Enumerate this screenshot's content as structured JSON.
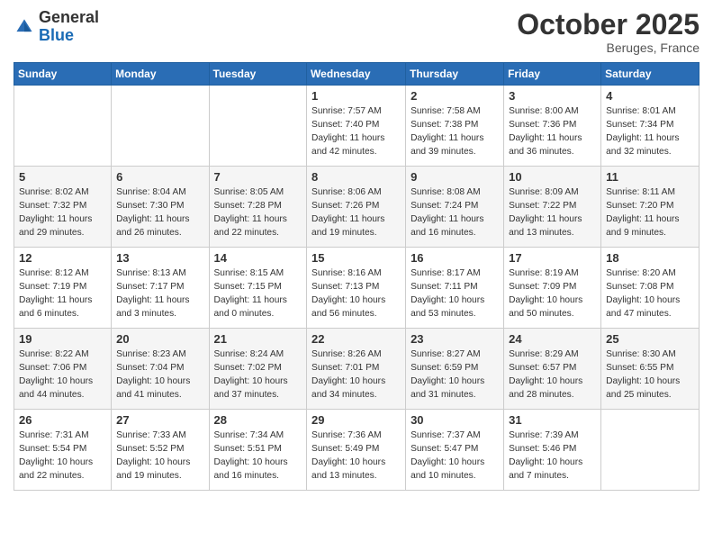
{
  "header": {
    "logo": {
      "general": "General",
      "blue": "Blue"
    },
    "title": "October 2025",
    "location": "Beruges, France"
  },
  "weekdays": [
    "Sunday",
    "Monday",
    "Tuesday",
    "Wednesday",
    "Thursday",
    "Friday",
    "Saturday"
  ],
  "weeks": [
    [
      {
        "day": "",
        "sunrise": "",
        "sunset": "",
        "daylight": ""
      },
      {
        "day": "",
        "sunrise": "",
        "sunset": "",
        "daylight": ""
      },
      {
        "day": "",
        "sunrise": "",
        "sunset": "",
        "daylight": ""
      },
      {
        "day": "1",
        "sunrise": "Sunrise: 7:57 AM",
        "sunset": "Sunset: 7:40 PM",
        "daylight": "Daylight: 11 hours and 42 minutes."
      },
      {
        "day": "2",
        "sunrise": "Sunrise: 7:58 AM",
        "sunset": "Sunset: 7:38 PM",
        "daylight": "Daylight: 11 hours and 39 minutes."
      },
      {
        "day": "3",
        "sunrise": "Sunrise: 8:00 AM",
        "sunset": "Sunset: 7:36 PM",
        "daylight": "Daylight: 11 hours and 36 minutes."
      },
      {
        "day": "4",
        "sunrise": "Sunrise: 8:01 AM",
        "sunset": "Sunset: 7:34 PM",
        "daylight": "Daylight: 11 hours and 32 minutes."
      }
    ],
    [
      {
        "day": "5",
        "sunrise": "Sunrise: 8:02 AM",
        "sunset": "Sunset: 7:32 PM",
        "daylight": "Daylight: 11 hours and 29 minutes."
      },
      {
        "day": "6",
        "sunrise": "Sunrise: 8:04 AM",
        "sunset": "Sunset: 7:30 PM",
        "daylight": "Daylight: 11 hours and 26 minutes."
      },
      {
        "day": "7",
        "sunrise": "Sunrise: 8:05 AM",
        "sunset": "Sunset: 7:28 PM",
        "daylight": "Daylight: 11 hours and 22 minutes."
      },
      {
        "day": "8",
        "sunrise": "Sunrise: 8:06 AM",
        "sunset": "Sunset: 7:26 PM",
        "daylight": "Daylight: 11 hours and 19 minutes."
      },
      {
        "day": "9",
        "sunrise": "Sunrise: 8:08 AM",
        "sunset": "Sunset: 7:24 PM",
        "daylight": "Daylight: 11 hours and 16 minutes."
      },
      {
        "day": "10",
        "sunrise": "Sunrise: 8:09 AM",
        "sunset": "Sunset: 7:22 PM",
        "daylight": "Daylight: 11 hours and 13 minutes."
      },
      {
        "day": "11",
        "sunrise": "Sunrise: 8:11 AM",
        "sunset": "Sunset: 7:20 PM",
        "daylight": "Daylight: 11 hours and 9 minutes."
      }
    ],
    [
      {
        "day": "12",
        "sunrise": "Sunrise: 8:12 AM",
        "sunset": "Sunset: 7:19 PM",
        "daylight": "Daylight: 11 hours and 6 minutes."
      },
      {
        "day": "13",
        "sunrise": "Sunrise: 8:13 AM",
        "sunset": "Sunset: 7:17 PM",
        "daylight": "Daylight: 11 hours and 3 minutes."
      },
      {
        "day": "14",
        "sunrise": "Sunrise: 8:15 AM",
        "sunset": "Sunset: 7:15 PM",
        "daylight": "Daylight: 11 hours and 0 minutes."
      },
      {
        "day": "15",
        "sunrise": "Sunrise: 8:16 AM",
        "sunset": "Sunset: 7:13 PM",
        "daylight": "Daylight: 10 hours and 56 minutes."
      },
      {
        "day": "16",
        "sunrise": "Sunrise: 8:17 AM",
        "sunset": "Sunset: 7:11 PM",
        "daylight": "Daylight: 10 hours and 53 minutes."
      },
      {
        "day": "17",
        "sunrise": "Sunrise: 8:19 AM",
        "sunset": "Sunset: 7:09 PM",
        "daylight": "Daylight: 10 hours and 50 minutes."
      },
      {
        "day": "18",
        "sunrise": "Sunrise: 8:20 AM",
        "sunset": "Sunset: 7:08 PM",
        "daylight": "Daylight: 10 hours and 47 minutes."
      }
    ],
    [
      {
        "day": "19",
        "sunrise": "Sunrise: 8:22 AM",
        "sunset": "Sunset: 7:06 PM",
        "daylight": "Daylight: 10 hours and 44 minutes."
      },
      {
        "day": "20",
        "sunrise": "Sunrise: 8:23 AM",
        "sunset": "Sunset: 7:04 PM",
        "daylight": "Daylight: 10 hours and 41 minutes."
      },
      {
        "day": "21",
        "sunrise": "Sunrise: 8:24 AM",
        "sunset": "Sunset: 7:02 PM",
        "daylight": "Daylight: 10 hours and 37 minutes."
      },
      {
        "day": "22",
        "sunrise": "Sunrise: 8:26 AM",
        "sunset": "Sunset: 7:01 PM",
        "daylight": "Daylight: 10 hours and 34 minutes."
      },
      {
        "day": "23",
        "sunrise": "Sunrise: 8:27 AM",
        "sunset": "Sunset: 6:59 PM",
        "daylight": "Daylight: 10 hours and 31 minutes."
      },
      {
        "day": "24",
        "sunrise": "Sunrise: 8:29 AM",
        "sunset": "Sunset: 6:57 PM",
        "daylight": "Daylight: 10 hours and 28 minutes."
      },
      {
        "day": "25",
        "sunrise": "Sunrise: 8:30 AM",
        "sunset": "Sunset: 6:55 PM",
        "daylight": "Daylight: 10 hours and 25 minutes."
      }
    ],
    [
      {
        "day": "26",
        "sunrise": "Sunrise: 7:31 AM",
        "sunset": "Sunset: 5:54 PM",
        "daylight": "Daylight: 10 hours and 22 minutes."
      },
      {
        "day": "27",
        "sunrise": "Sunrise: 7:33 AM",
        "sunset": "Sunset: 5:52 PM",
        "daylight": "Daylight: 10 hours and 19 minutes."
      },
      {
        "day": "28",
        "sunrise": "Sunrise: 7:34 AM",
        "sunset": "Sunset: 5:51 PM",
        "daylight": "Daylight: 10 hours and 16 minutes."
      },
      {
        "day": "29",
        "sunrise": "Sunrise: 7:36 AM",
        "sunset": "Sunset: 5:49 PM",
        "daylight": "Daylight: 10 hours and 13 minutes."
      },
      {
        "day": "30",
        "sunrise": "Sunrise: 7:37 AM",
        "sunset": "Sunset: 5:47 PM",
        "daylight": "Daylight: 10 hours and 10 minutes."
      },
      {
        "day": "31",
        "sunrise": "Sunrise: 7:39 AM",
        "sunset": "Sunset: 5:46 PM",
        "daylight": "Daylight: 10 hours and 7 minutes."
      },
      {
        "day": "",
        "sunrise": "",
        "sunset": "",
        "daylight": ""
      }
    ]
  ]
}
